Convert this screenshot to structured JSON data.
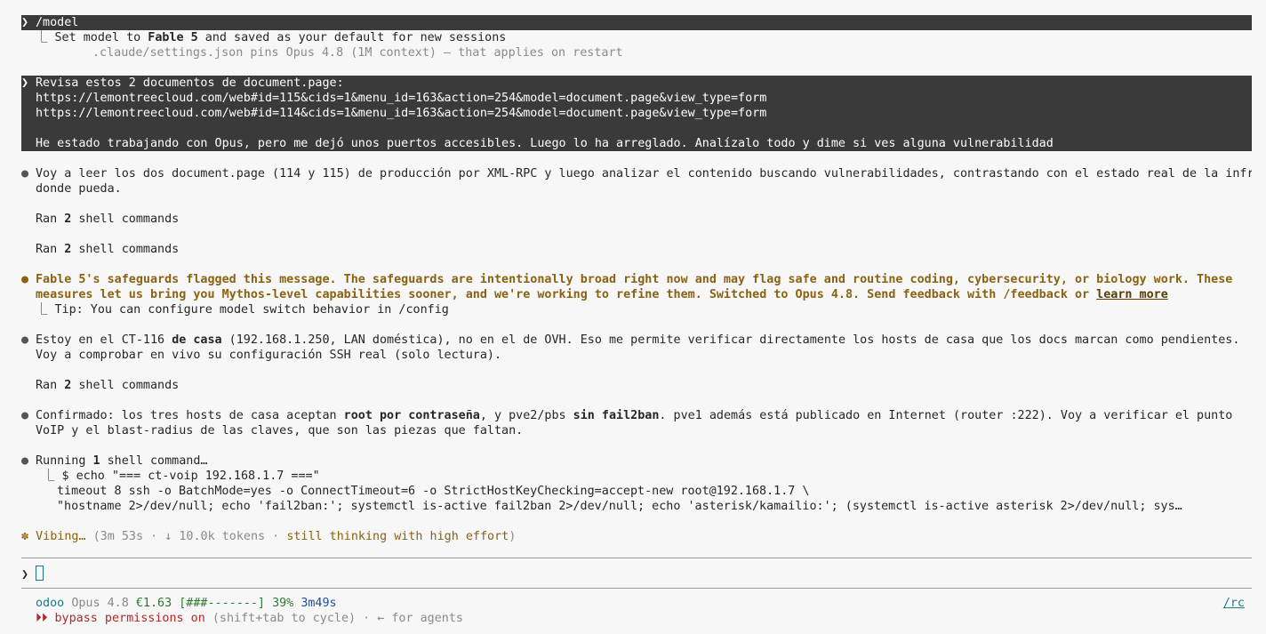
{
  "prompt1": {
    "text": "/model"
  },
  "model_result": {
    "prefix": "Set model to ",
    "model": "Fable 5",
    "suffix": " and saved as your default for new sessions",
    "note": ".claude/settings.json pins Opus 4.8 (1M context) — that applies on restart"
  },
  "prompt2": {
    "line1": "Revisa estos 2 documentos de document.page:",
    "line2": "https://lemontreecloud.com/web#id=115&cids=1&menu_id=163&action=254&model=document.page&view_type=form",
    "line3": "https://lemontreecloud.com/web#id=114&cids=1&menu_id=163&action=254&model=document.page&view_type=form",
    "line4": "He estado trabajando con Opus, pero me dejó unos puertos accesibles. Luego lo ha arreglado. Analízalo todo y dime si ves alguna vulnerabilidad"
  },
  "msg1": {
    "line1": "Voy a leer los dos document.page (114 y 115) de producción por XML-RPC y luego analizar el contenido buscando vulnerabilidades, contrastando con el estado real de la infra",
    "line2": "donde pueda."
  },
  "ran1": {
    "pre": "Ran ",
    "count": "2",
    "post": " shell commands"
  },
  "ran2": {
    "pre": "Ran ",
    "count": "2",
    "post": " shell commands"
  },
  "warning": {
    "line1": "Fable 5's safeguards flagged this message. The safeguards are intentionally broad right now and may flag safe and routine coding, cybersecurity, or biology work. These",
    "line2": "measures let us bring you Mythos-level capabilities sooner, and we're working to refine them. Switched to Opus 4.8. Send feedback with /feedback or ",
    "link": "learn more",
    "tip": "Tip: You can configure model switch behavior in /config"
  },
  "msg2": {
    "p1": "Estoy en el CT-116 ",
    "b1": "de casa",
    "p2": " (192.168.1.250, LAN doméstica), no en el de OVH. Eso me permite verificar directamente los hosts de casa que los docs marcan como pendientes.",
    "line2": "Voy a comprobar en vivo su configuración SSH real (solo lectura)."
  },
  "ran3": {
    "pre": "Ran ",
    "count": "2",
    "post": " shell commands"
  },
  "msg3": {
    "p1": "Confirmado: los tres hosts de casa aceptan ",
    "b1": "root por contraseña",
    "p2": ", y pve2/pbs ",
    "b2": "sin fail2ban",
    "p3": ". pve1 además está publicado en Internet (router :222). Voy a verificar el punto",
    "line2": "VoIP y el blast-radius de las claves, que son las piezas que faltan."
  },
  "running": {
    "pre": "Running ",
    "count": "1",
    "post": " shell command…",
    "cmd1": "$ echo \"=== ct-voip 192.168.1.7 ===\"",
    "cmd2": "timeout 8 ssh -o BatchMode=yes -o ConnectTimeout=6 -o StrictHostKeyChecking=accept-new root@192.168.1.7 \\",
    "cmd3": "\"hostname 2>/dev/null; echo 'fail2ban:'; systemctl is-active fail2ban 2>/dev/null; echo 'asterisk/kamailio:'; (systemctl is-active asterisk 2>/dev/null; sys…"
  },
  "spinner": {
    "glyph": "✽",
    "word": "Vibing…",
    "open": " (",
    "time": "3m 53s",
    "tokens": " · ↓ 10.0k tokens · ",
    "thinking": "still thinking with high effort",
    "close": ")"
  },
  "input": {
    "prompt_glyph": "❯",
    "value": ""
  },
  "status": {
    "project": "odoo",
    "model": "Opus 4.8",
    "cost": "€1.63",
    "bar": "[###-------]",
    "percent": "39%",
    "elapsed": "3m49s",
    "rc": "/rc",
    "mode_glyph": "⏵⏵",
    "mode": "bypass permissions on",
    "mode_hint": " (shift+tab to cycle) · ← for agents"
  },
  "glyphs": {
    "prompt": "❯",
    "bullet": "●",
    "branch": "⎿"
  },
  "colors": {
    "background": "#f7f7f7",
    "prompt_bg": "#3a3a3a",
    "warning": "#8a6212",
    "accent": "#1e7a8a",
    "cost": "#2f7a2f",
    "elapsed": "#1f4f9a",
    "mode": "#b02a2a"
  }
}
